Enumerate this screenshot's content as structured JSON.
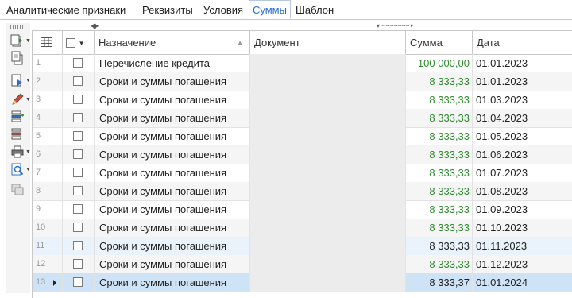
{
  "tabs": [
    {
      "label": "Аналитические признаки",
      "active": false
    },
    {
      "label": "Реквизиты",
      "active": false
    },
    {
      "label": "Условия",
      "active": false
    },
    {
      "label": "Суммы",
      "active": true
    },
    {
      "label": "Шаблон",
      "active": false
    }
  ],
  "toolbar": {
    "buttons": [
      {
        "icon": "add-document-icon"
      },
      {
        "icon": "copy-document-icon"
      },
      {
        "icon": "document-options-icon"
      },
      {
        "icon": "edit-pencil-icon"
      },
      {
        "icon": "add-row-icon"
      },
      {
        "icon": "delete-row-icon"
      },
      {
        "icon": "print-icon"
      },
      {
        "icon": "preview-icon"
      },
      {
        "icon": "duplicate-icon"
      }
    ]
  },
  "colors": {
    "accent": "#2a6fc9",
    "amount_green": "#2e8b2e",
    "current_row": "#cfe3f7",
    "selected_row": "#eaf2fb"
  },
  "grid": {
    "headers": {
      "name": "Назначение",
      "document": "Документ",
      "sum": "Сумма",
      "date": "Дата"
    },
    "rows": [
      {
        "n": "1",
        "name": "Перечисление кредита",
        "document": "",
        "sum": "100 000,00",
        "date": "01.01.2023",
        "state": "normal",
        "sum_color": "green"
      },
      {
        "n": "2",
        "name": "Сроки и суммы погашения",
        "document": "",
        "sum": "8 333,33",
        "date": "01.01.2023",
        "state": "alt",
        "sum_color": "green"
      },
      {
        "n": "3",
        "name": "Сроки и суммы погашения",
        "document": "",
        "sum": "8 333,33",
        "date": "01.03.2023",
        "state": "normal",
        "sum_color": "green"
      },
      {
        "n": "4",
        "name": "Сроки и суммы погашения",
        "document": "",
        "sum": "8 333,33",
        "date": "01.04.2023",
        "state": "alt",
        "sum_color": "green"
      },
      {
        "n": "5",
        "name": "Сроки и суммы погашения",
        "document": "",
        "sum": "8 333,33",
        "date": "01.05.2023",
        "state": "normal",
        "sum_color": "green"
      },
      {
        "n": "6",
        "name": "Сроки и суммы погашения",
        "document": "",
        "sum": "8 333,33",
        "date": "01.06.2023",
        "state": "alt",
        "sum_color": "green"
      },
      {
        "n": "7",
        "name": "Сроки и суммы погашения",
        "document": "",
        "sum": "8 333,33",
        "date": "01.07.2023",
        "state": "normal",
        "sum_color": "green"
      },
      {
        "n": "8",
        "name": "Сроки и суммы погашения",
        "document": "",
        "sum": "8 333,33",
        "date": "01.08.2023",
        "state": "alt",
        "sum_color": "green"
      },
      {
        "n": "9",
        "name": "Сроки и суммы погашения",
        "document": "",
        "sum": "8 333,33",
        "date": "01.09.2023",
        "state": "normal",
        "sum_color": "green"
      },
      {
        "n": "10",
        "name": "Сроки и суммы погашения",
        "document": "",
        "sum": "8 333,33",
        "date": "01.10.2023",
        "state": "alt",
        "sum_color": "green"
      },
      {
        "n": "11",
        "name": "Сроки и суммы погашения",
        "document": "",
        "sum": "8 333,33",
        "date": "01.11.2023",
        "state": "selected",
        "sum_color": "dark"
      },
      {
        "n": "12",
        "name": "Сроки и суммы погашения",
        "document": "",
        "sum": "8 333,33",
        "date": "01.12.2023",
        "state": "alt",
        "sum_color": "green"
      },
      {
        "n": "13",
        "name": "Сроки и суммы погашения",
        "document": "",
        "sum": "8 333,37",
        "date": "01.01.2024",
        "state": "current",
        "sum_color": "dark"
      }
    ]
  }
}
